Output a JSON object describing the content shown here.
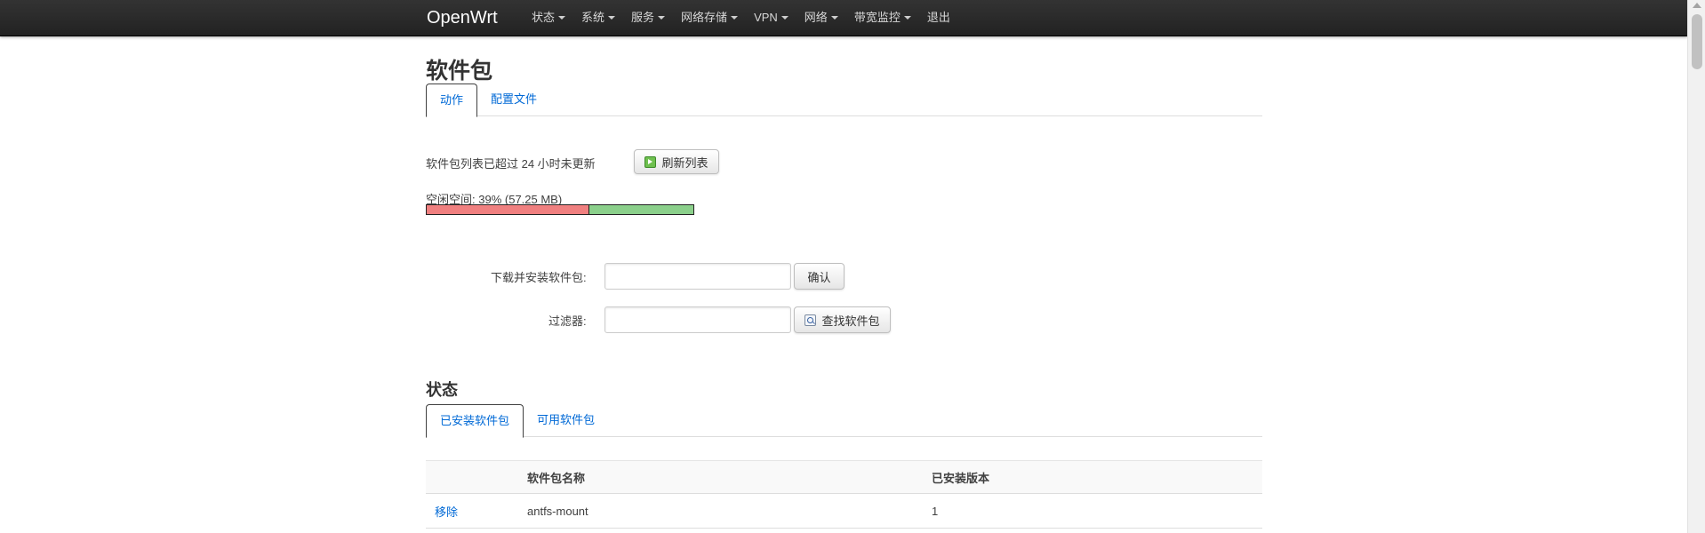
{
  "nav": {
    "brand": "OpenWrt",
    "items": [
      {
        "label": "状态",
        "dropdown": true
      },
      {
        "label": "系统",
        "dropdown": true
      },
      {
        "label": "服务",
        "dropdown": true
      },
      {
        "label": "网络存储",
        "dropdown": true
      },
      {
        "label": "VPN",
        "dropdown": true
      },
      {
        "label": "网络",
        "dropdown": true
      },
      {
        "label": "带宽监控",
        "dropdown": true
      },
      {
        "label": "退出",
        "dropdown": false
      }
    ]
  },
  "page": {
    "title": "软件包",
    "tabs": [
      {
        "label": "动作",
        "active": true
      },
      {
        "label": "配置文件",
        "active": false
      }
    ]
  },
  "actions": {
    "update_notice": "软件包列表已超过 24 小时未更新",
    "refresh_button": "刷新列表",
    "free_space_label": "空闲空间:",
    "free_space_value": "39% (57.25 MB)",
    "free_fraction": 0.39,
    "download_label": "下载并安装软件包:",
    "download_value": "",
    "confirm_button": "确认",
    "filter_label": "过滤器:",
    "filter_value": "",
    "find_button": "查找软件包"
  },
  "status": {
    "title": "状态",
    "tabs": [
      {
        "label": "已安装软件包",
        "active": true
      },
      {
        "label": "可用软件包",
        "active": false
      }
    ],
    "table": {
      "headers": [
        "",
        "软件包名称",
        "已安装版本"
      ],
      "rows": [
        {
          "action": "移除",
          "name": "antfs-mount",
          "version": "1"
        }
      ]
    }
  },
  "colors": {
    "link": "#0069d6",
    "used_bar": "#f08080",
    "free_bar": "#8bd08b",
    "topbar": "#222222"
  },
  "icons": {
    "refresh": "refresh-icon",
    "search": "search-icon",
    "dropdown": "caret-down-icon"
  }
}
